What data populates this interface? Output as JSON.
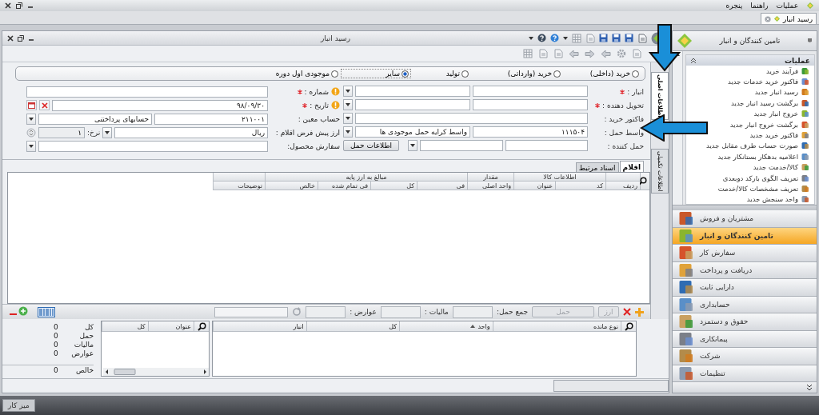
{
  "menu_bar": {
    "items": [
      "عملیات",
      "راهنما",
      "پنجره"
    ]
  },
  "document_tabs": [
    {
      "label": "رسید انبار",
      "selected": true
    }
  ],
  "window": {
    "title": "رسید انبار"
  },
  "side_tabs": [
    {
      "label": "اطلاعات اصلی",
      "selected": true
    },
    {
      "label": "اطلاعات تکمیلی",
      "selected": false
    }
  ],
  "receipt_type": [
    {
      "label": "خرید (داخلی)",
      "selected": false
    },
    {
      "label": "خرید (وارداتی)",
      "selected": false
    },
    {
      "label": "تولید",
      "selected": false
    },
    {
      "label": "سایر",
      "selected": true
    },
    {
      "label": "موجودی اول دوره",
      "selected": false
    }
  ],
  "form_rows": [
    {
      "label": "انبار :",
      "required": true,
      "fields": [
        {
          "kind": "text"
        },
        {
          "kind": "text"
        },
        {
          "kind": "combo"
        }
      ],
      "warning": true,
      "label_2": "شماره :",
      "required_2": true,
      "fields_2": [
        {
          "kind": "text"
        }
      ]
    },
    {
      "label": "تحویل دهنده :",
      "required": true,
      "fields": [
        {
          "kind": "text"
        },
        {
          "kind": "text"
        },
        {
          "kind": "combo"
        }
      ],
      "warning": true,
      "label_2": "تاریخ :",
      "required_2": true,
      "fields_2": [
        {
          "kind": "text",
          "value": "۹۸/۰۹/۳۰"
        },
        {
          "kind": "clear"
        },
        {
          "kind": "calendar"
        }
      ]
    },
    {
      "label": "فاکتور خرید :",
      "required": false,
      "fields": [
        {
          "kind": "text"
        },
        {
          "kind": "combo"
        }
      ],
      "warning": false,
      "label_2": "حساب معین :",
      "required_2": false,
      "fields_2": [
        {
          "kind": "text",
          "value": "۲۱۱۰۰۱"
        },
        {
          "kind": "text",
          "value": "حسابهای پرداختنی"
        },
        {
          "kind": "combo"
        }
      ]
    },
    {
      "label": "واسط حمل :",
      "required": false,
      "fields": [
        {
          "kind": "text",
          "value": "۱۱۱۵۰۴"
        },
        {
          "kind": "text",
          "value": "واسط کرایه حمل موجودی ها"
        },
        {
          "kind": "combo"
        }
      ],
      "warning": false,
      "label_2": "ارز پیش فرض اقلام :",
      "required_2": false,
      "fields_2": [
        {
          "kind": "text",
          "value": "ریال"
        },
        {
          "kind": "combo"
        },
        {
          "kind": "label",
          "label": "نرخ:"
        },
        {
          "kind": "spin",
          "value": "۱"
        }
      ]
    },
    {
      "label": "حمل کننده :",
      "required": false,
      "fields": [
        {
          "kind": "text"
        },
        {
          "kind": "text"
        },
        {
          "kind": "combo"
        },
        {
          "kind": "button",
          "label": "اطلاعات حمل"
        }
      ],
      "warning": false,
      "label_2": "سفارش محصول:",
      "required_2": false,
      "fields_2": [
        {
          "kind": "text"
        },
        {
          "kind": "combo"
        }
      ]
    }
  ],
  "item_tabs": [
    {
      "label": "اقلام",
      "selected": true
    },
    {
      "label": "اسناد مرتبط",
      "selected": false
    }
  ],
  "items_table": {
    "column_groups": [
      {
        "columns": [
          {
            "label": "ردیف"
          }
        ]
      },
      {
        "label": "اطلاعات کالا",
        "columns": [
          {
            "label": "کد"
          },
          {
            "label": "عنوان"
          }
        ]
      },
      {
        "label": "مقدار",
        "columns": [
          {
            "label": "واحد اصلی"
          }
        ]
      },
      {
        "label": "مبالغ به ارز پایه",
        "columns": [
          {
            "label": "فی"
          },
          {
            "label": "کل"
          },
          {
            "label": "فی تمام شده"
          },
          {
            "label": "خالص"
          }
        ]
      },
      {
        "columns": [
          {
            "label": "توضیحات"
          }
        ]
      }
    ]
  },
  "item_toolbar": {
    "buttons": [
      {
        "label": "ارز",
        "disabled": true
      },
      {
        "label": "حمل",
        "disabled": true
      }
    ],
    "totals": [
      {
        "label": "جمع حمل:"
      },
      {
        "label": "مالیات :"
      },
      {
        "label": "عوارض :"
      }
    ]
  },
  "balance_table": {
    "columns": [
      {
        "label": "نوع مانده",
        "sorted": false
      },
      {
        "label": "واحد",
        "sorted": true
      },
      {
        "label": "کل",
        "sorted": false
      },
      {
        "label": "انبار",
        "sorted": false
      }
    ]
  },
  "costs_table": {
    "columns": [
      {
        "label": "عنوان"
      },
      {
        "label": "کل"
      }
    ]
  },
  "summary": [
    {
      "label": "کل",
      "value": "0"
    },
    {
      "label": "حمل",
      "value": "0"
    },
    {
      "label": "مالیات",
      "value": "0"
    },
    {
      "label": "عوارض",
      "value": "0"
    },
    {
      "label": "خالص",
      "value": "0"
    }
  ],
  "nav_panel": {
    "title": "تامین کنندگان و انبار",
    "section": {
      "title": "عملیات",
      "expanded": true,
      "items": [
        "فرآیند خرید",
        "فاکتور خرید خدمات جدید",
        "رسید انبار جدید",
        "برگشت رسید انبار جدید",
        "خروج انبار جدید",
        "برگشت خروج انبار جدید",
        "فاکتور خرید جدید",
        "صورت حساب طرف مقابل جدید",
        "اعلامیه بدهکار بستانکار جدید",
        "کالا/خدمت جدید",
        "تعریف الگوی بارکد دوبعدی",
        "تعریف مشخصات کالا/خدمت",
        "واحد سنجش جدید"
      ]
    },
    "modules": [
      {
        "label": "مشتریان و فروش",
        "selected": false
      },
      {
        "label": "تامین کنندگان و انبار",
        "selected": true
      },
      {
        "label": "سفارش کار",
        "selected": false
      },
      {
        "label": "دریافت و پرداخت",
        "selected": false
      },
      {
        "label": "دارایی ثابت",
        "selected": false
      },
      {
        "label": "حسابداری",
        "selected": false
      },
      {
        "label": "حقوق و دستمزد",
        "selected": false
      },
      {
        "label": "پیمانکاری",
        "selected": false
      },
      {
        "label": "شرکت",
        "selected": false
      },
      {
        "label": "تنظیمات",
        "selected": false
      }
    ]
  },
  "taskbar": {
    "button": "میز کار"
  }
}
